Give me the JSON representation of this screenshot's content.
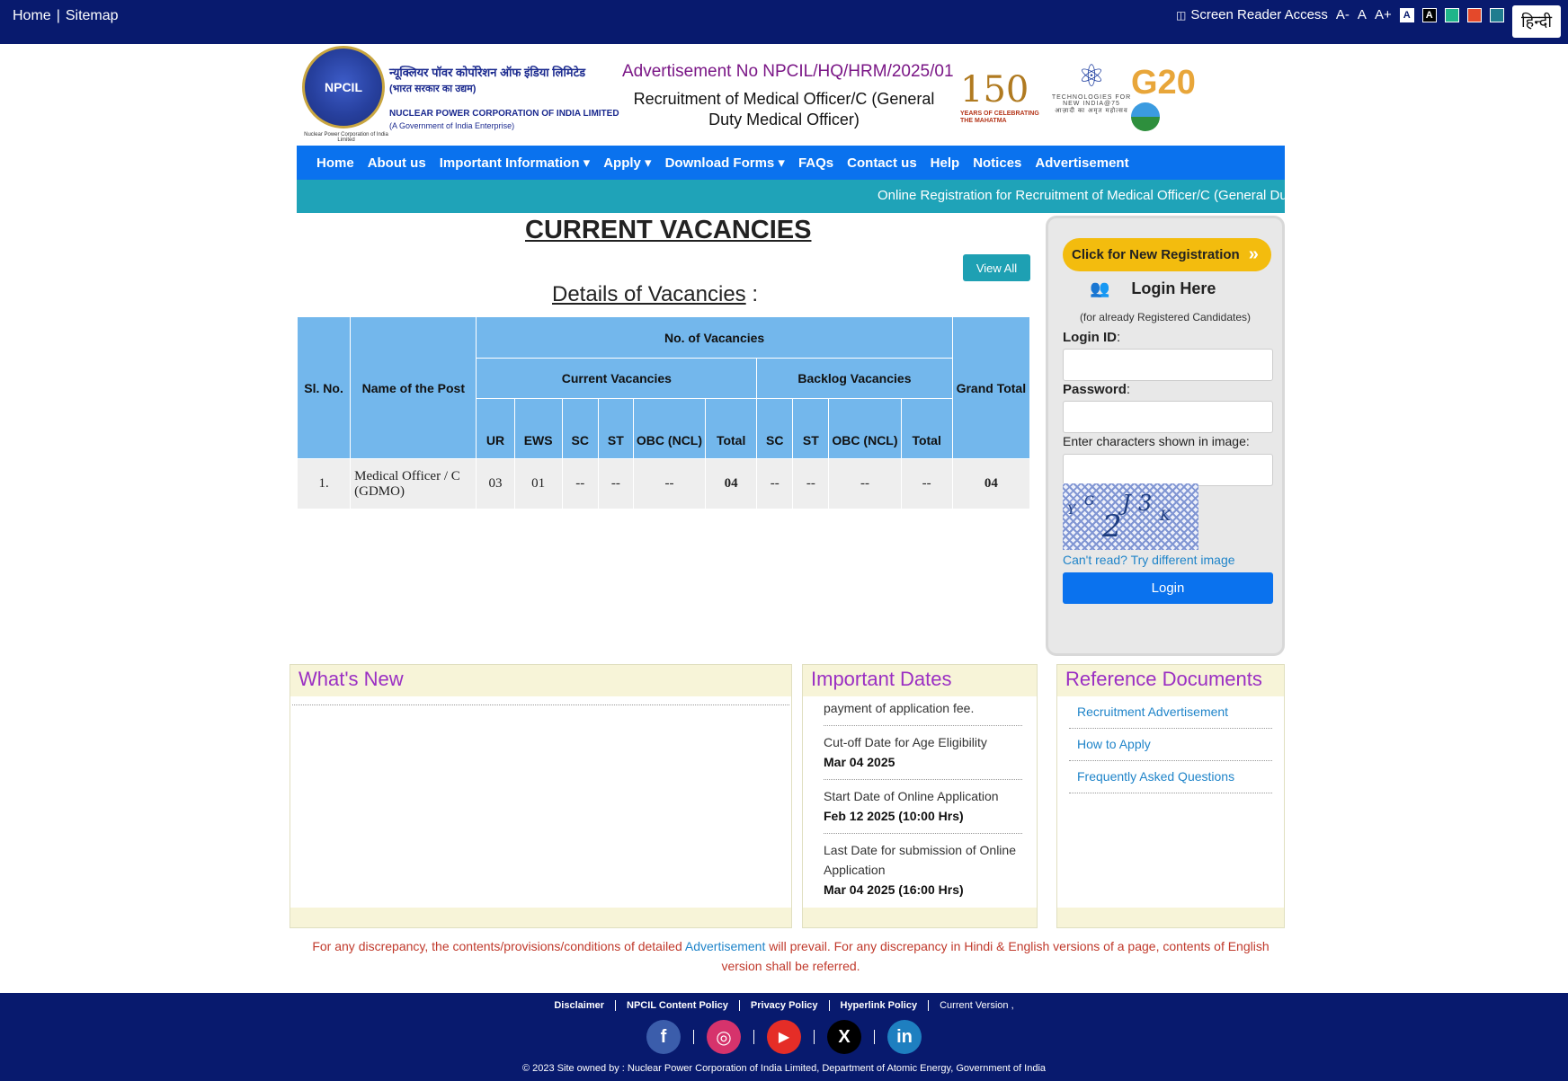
{
  "topbar": {
    "home": "Home",
    "sitemap": "Sitemap",
    "screen_reader": "Screen Reader Access",
    "font_small": "A-",
    "font_normal": "A",
    "font_large": "A+",
    "contrast_white": "A",
    "contrast_black": "A",
    "hindi": "हिन्दी",
    "theme_colors": [
      "#1fb58a",
      "#e4492b",
      "#1f7d8f"
    ]
  },
  "header": {
    "logo_text": "NPCIL",
    "logo_caption": "Nuclear Power Corporation of India Limited",
    "org_name_hindi": "न्यूक्लियर पॉवर कोर्पोरेशन ऑफ इंडिया लिमिटेड",
    "org_sub_hindi": "(भारत सरकार का उद्यम)",
    "org_name_en": "NUCLEAR POWER CORPORATION OF INDIA LIMITED",
    "org_sub_en": "(A Government of India Enterprise)",
    "advt_no": "Advertisement No NPCIL/HQ/HRM/2025/01",
    "advt_title": "Recruitment of Medical Officer/C (General Duty Medical Officer)",
    "badge_150_num": "150",
    "badge_150_text": "YEARS OF CELEBRATING THE MAHATMA",
    "tech_text": "TECHNOLOGIES FOR NEW INDIA@75",
    "tech_hindi": "आज़ादी का अमृत महोत्सव",
    "g20_text": "G20"
  },
  "nav": {
    "items": [
      "Home",
      "About us",
      "Important Information ▾",
      "Apply ▾",
      "Download Forms ▾",
      "FAQs",
      "Contact us",
      "Help",
      "Notices",
      "Advertisement"
    ]
  },
  "ticker": {
    "text": "Online Registration for Recruitment of Medical Officer/C (General Duty Medical Officer)"
  },
  "vacancies": {
    "title": "CURRENT VACANCIES",
    "view_all": "View All",
    "details_title": "Details of Vacancies",
    "details_colon": " :",
    "headers": {
      "sl_no": "Sl. No.",
      "name": "Name of the Post",
      "no_of_vacancies": "No. of Vacancies",
      "current": "Current Vacancies",
      "backlog": "Backlog Vacancies",
      "grand_total": "Grand Total",
      "current_cols": [
        "UR",
        "EWS",
        "SC",
        "ST",
        "OBC (NCL)",
        "Total"
      ],
      "backlog_cols": [
        "SC",
        "ST",
        "OBC (NCL)",
        "Total"
      ]
    },
    "rows": [
      {
        "sl": "1.",
        "name": "Medical Officer / C (GDMO)",
        "ur": "03",
        "ews": "01",
        "sc": "--",
        "st": "--",
        "obc": "--",
        "total": "04",
        "b_sc": "--",
        "b_st": "--",
        "b_obc": "--",
        "b_total": "--",
        "grand": "04"
      }
    ]
  },
  "login": {
    "new_registration": "Click for New Registration",
    "login_here": "Login Here",
    "sub": "(for already Registered Candidates)",
    "login_id_label": "Login ID",
    "password_label": "Password",
    "captcha_label": "Enter characters shown in image:",
    "captcha_chars": [
      "Y",
      "G",
      "2",
      "J",
      "3",
      "K"
    ],
    "try_link": "Can't read? Try different image",
    "login_button": "Login"
  },
  "whats_new": {
    "title": "What's New"
  },
  "important_dates": {
    "title": "Important Dates",
    "partial_top": "payment of application fee.",
    "items": [
      {
        "label": "Cut-off Date for Age Eligibility",
        "date": "Mar 04 2025"
      },
      {
        "label": "Start Date of Online Application",
        "date": "Feb 12 2025 (10:00 Hrs)"
      },
      {
        "label": "Last Date for submission of Online Application",
        "date": "Mar 04 2025 (16:00 Hrs)"
      }
    ]
  },
  "reference_docs": {
    "title": "Reference Documents",
    "items": [
      "Recruitment Advertisement",
      "How to Apply",
      "Frequently Asked Questions"
    ]
  },
  "disclaimer": {
    "part1": "For any discrepancy, the contents/provisions/conditions of detailed ",
    "link": "Advertisement",
    "part2": " will prevail. For any discrepancy in Hindi & English versions of a page, contents of English version shall be referred."
  },
  "footer": {
    "links": [
      "Disclaimer",
      "NPCIL Content Policy",
      "Privacy Policy",
      "Hyperlink Policy",
      "Current Version ,"
    ],
    "social": [
      {
        "name": "facebook",
        "glyph": "f",
        "color": "#3b5dab"
      },
      {
        "name": "instagram",
        "glyph": "◎",
        "color": "#d6336c"
      },
      {
        "name": "youtube",
        "glyph": "▶",
        "color": "#e52d27"
      },
      {
        "name": "x",
        "glyph": "X",
        "color": "#000000"
      },
      {
        "name": "linkedin",
        "glyph": "in",
        "color": "#1e7fc0"
      }
    ],
    "copyright": "© 2023 Site owned by : Nuclear Power Corporation of India Limited, Department of Atomic Energy, Government of India"
  }
}
